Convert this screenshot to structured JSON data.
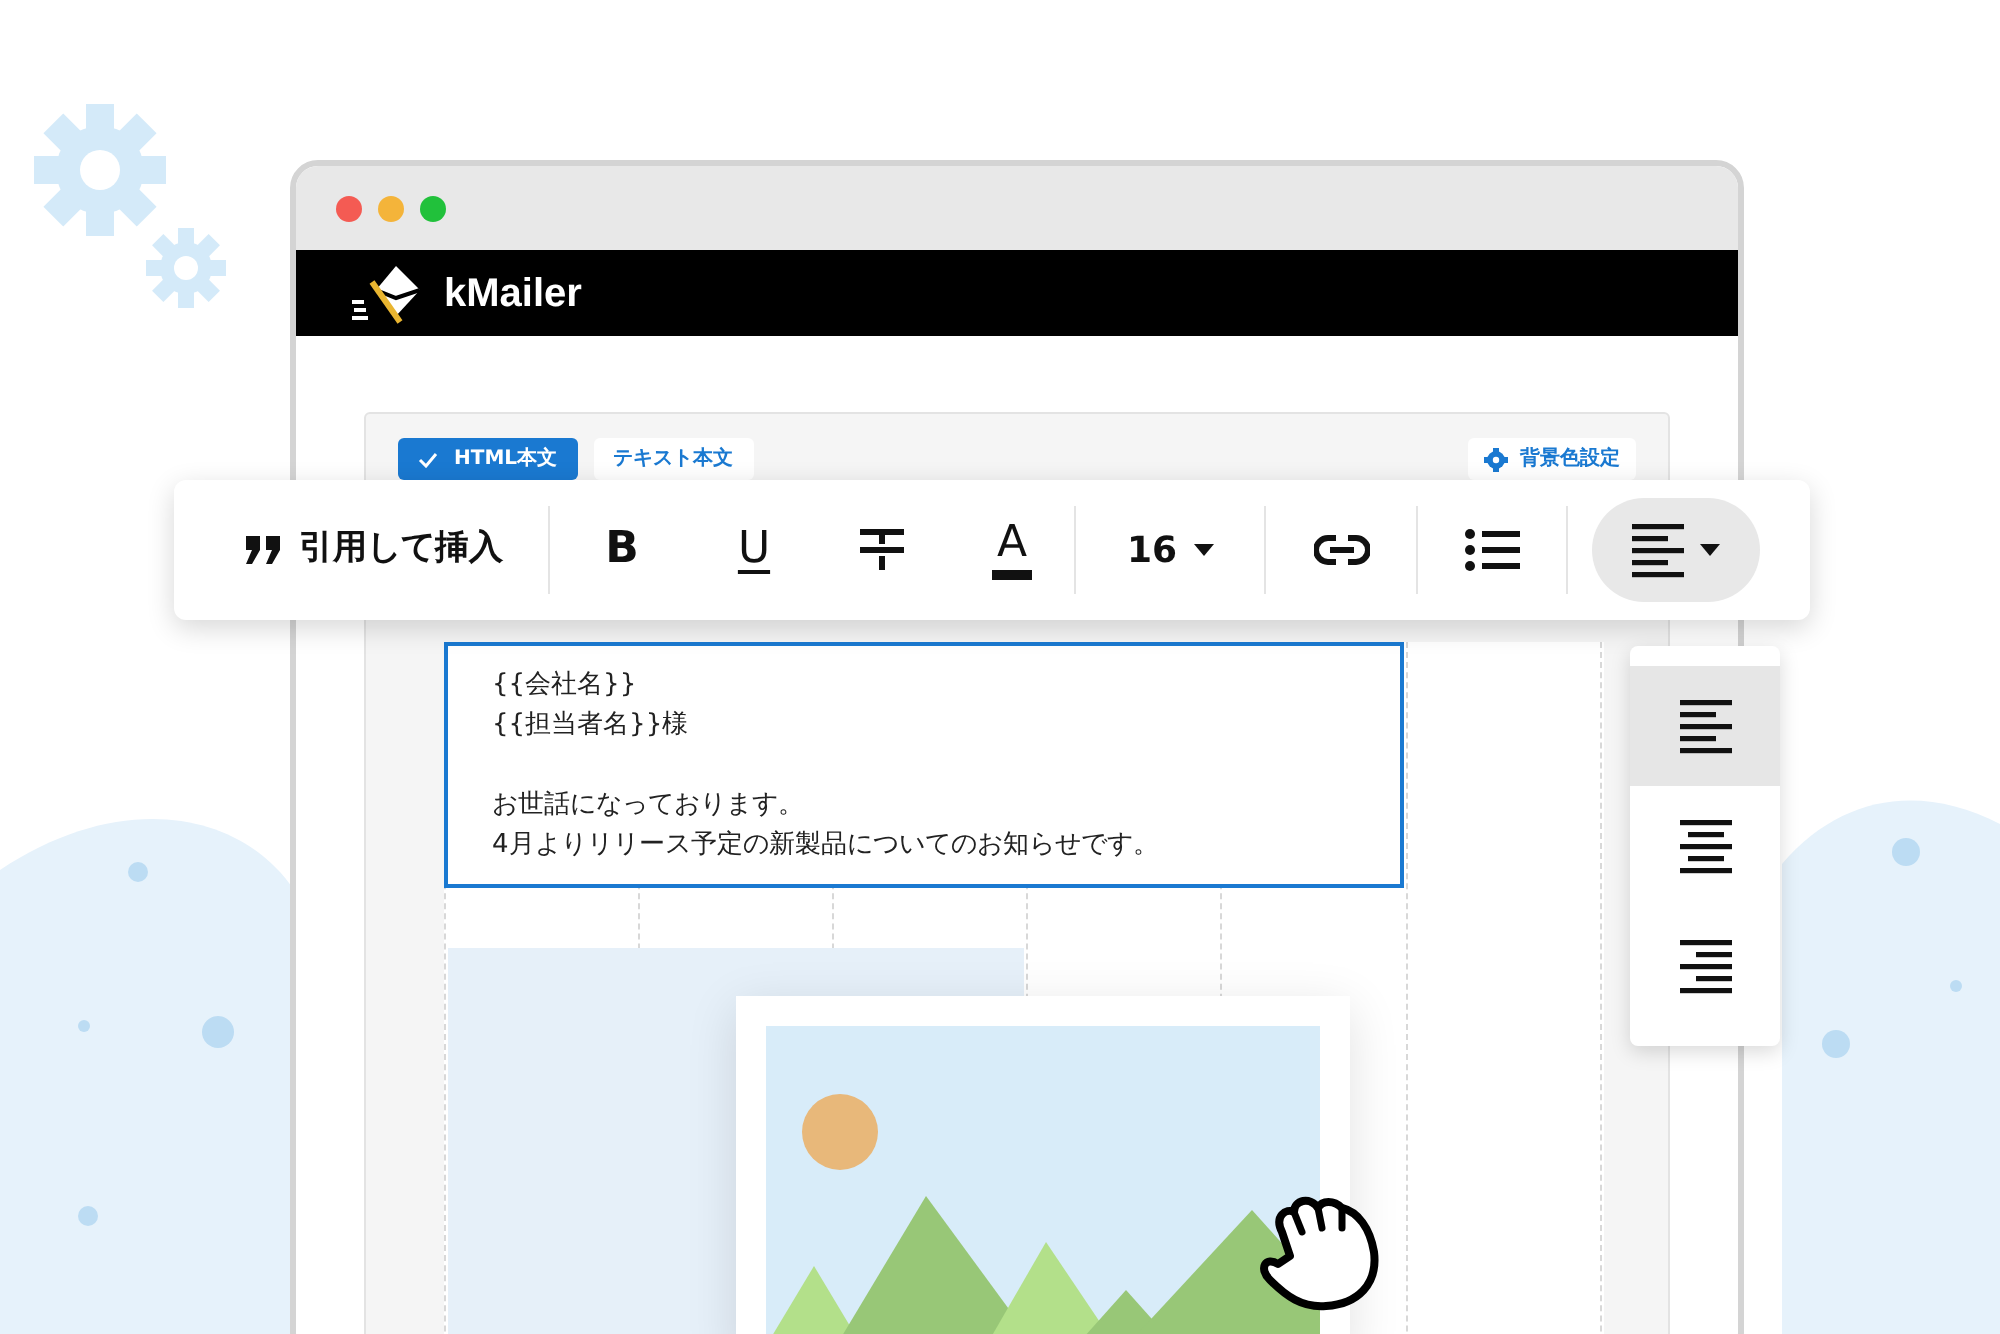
{
  "app": {
    "name": "kMailer"
  },
  "tabs": [
    {
      "label": "HTML本文",
      "selected": true
    },
    {
      "label": "テキスト本文",
      "selected": false
    }
  ],
  "background_button": {
    "label": "背景色設定"
  },
  "toolbar": {
    "items": [
      {
        "kind": "quote",
        "label": "引用して挿入"
      },
      {
        "kind": "bold",
        "label": "B"
      },
      {
        "kind": "underline",
        "label": "U"
      },
      {
        "kind": "strike"
      },
      {
        "kind": "color",
        "label": "A"
      },
      {
        "kind": "size",
        "label": "16"
      },
      {
        "kind": "link"
      },
      {
        "kind": "list"
      },
      {
        "kind": "align",
        "expanded": true
      }
    ]
  },
  "editor": {
    "paragraphs": [
      [
        "{{会社名}}",
        "{{担当者名}}様"
      ],
      [
        "お世話になっております。",
        "4月よりリリース予定の新製品についてのお知らせです。"
      ]
    ]
  },
  "align_menu": {
    "options": [
      {
        "kind": "left",
        "selected": true
      },
      {
        "kind": "center",
        "selected": false
      },
      {
        "kind": "right",
        "selected": false
      }
    ]
  }
}
